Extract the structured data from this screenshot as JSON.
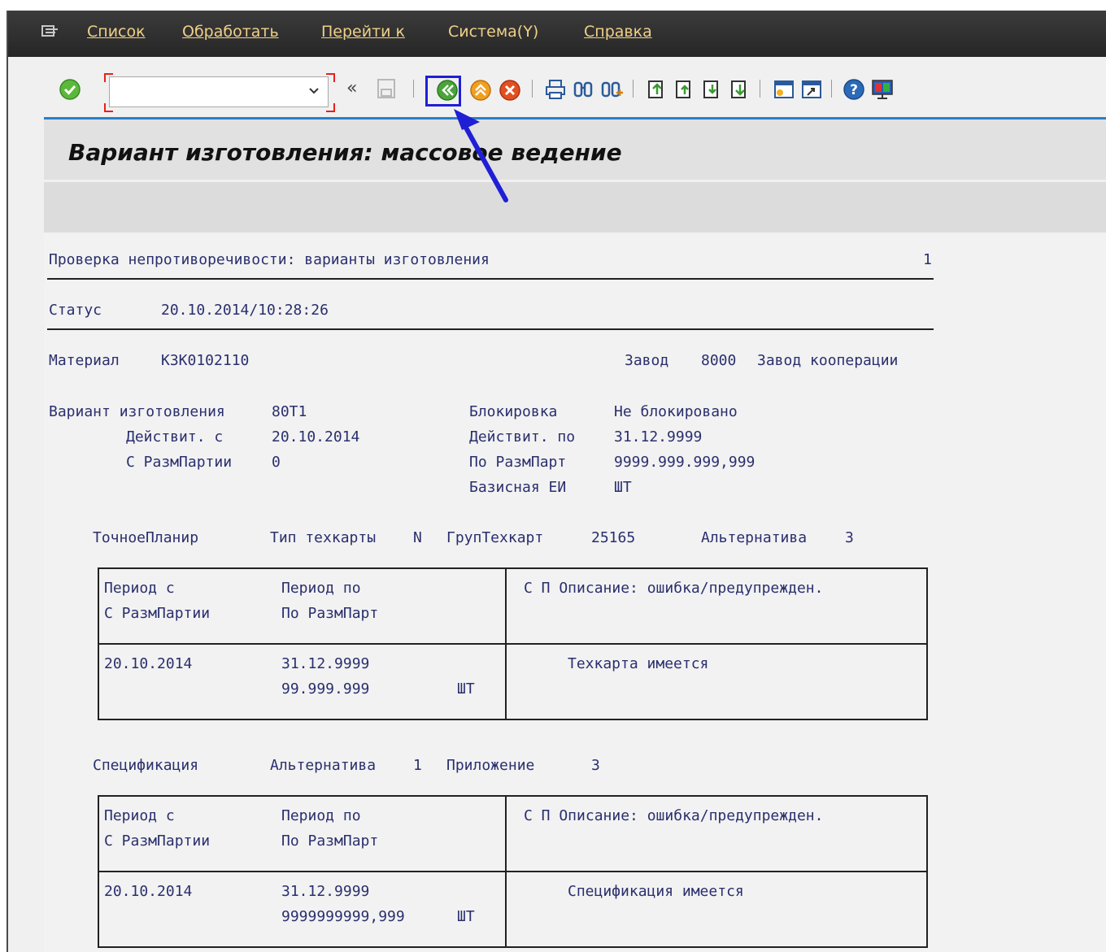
{
  "menu": {
    "items": [
      "Список",
      "Обработать",
      "Перейти к",
      "Система(Y)",
      "Справка"
    ]
  },
  "toolbar": {
    "command_value": "",
    "icons": [
      "enter-icon",
      "history-icon",
      "save-icon",
      "back-icon",
      "exit-icon",
      "cancel-icon",
      "print-icon",
      "find-icon",
      "find-next-icon",
      "first-page-icon",
      "previous-page-icon",
      "next-page-icon",
      "last-page-icon",
      "new-session-icon",
      "shortcut-icon",
      "help-icon",
      "customize-layout-icon"
    ],
    "highlighted": "back-icon"
  },
  "page": {
    "title": "Вариант изготовления: массовое ведение"
  },
  "report": {
    "header_title": "Проверка непротиворечивости: варианты изготовления",
    "page_number": "1",
    "status_label": "Статус",
    "status_value": "20.10.2014/10:28:26",
    "material_label": "Материал",
    "material_value": "КЗК0102110",
    "plant_label": "Завод",
    "plant_code": "8000",
    "plant_name": "Завод кооперации",
    "version_label": "Вариант изготовления",
    "version_value": "80Т1",
    "valid_from_label": "Действит. с",
    "valid_from_value": "20.10.2014",
    "lot_from_label": "С РазмПартии",
    "lot_from_value": "0",
    "lock_label": "Блокировка",
    "lock_value": "Не блокировано",
    "valid_to_label": "Действит. по",
    "valid_to_value": "31.12.9999",
    "lot_to_label": "По РазмПарт",
    "lot_to_value": "9999.999.999,999",
    "base_uom_label": "Базисная ЕИ",
    "base_uom_value": "ШТ",
    "routing_section": {
      "label": "ТочноеПланир",
      "type_label": "Тип техкарты",
      "type_value": "N",
      "group_label": "ГрупТехкарт",
      "group_value": "25165",
      "alt_label": "Альтернатива",
      "alt_value": "3"
    },
    "routing_table": {
      "h_period_from": "Период с",
      "h_lot_from": "С РазмПартии",
      "h_period_to": "Период по",
      "h_lot_to": "По РазмПарт",
      "h_desc": "С П Описание: ошибка/предупрежден.",
      "period_from": "20.10.2014",
      "period_to": "31.12.9999",
      "lot_to": "99.999.999",
      "uom": "ШТ",
      "desc": "Техкарта имеется"
    },
    "bom_section": {
      "label": "Спецификация",
      "alt_label": "Альтернатива",
      "alt_value": "1",
      "usage_label": "Приложение",
      "usage_value": "3"
    },
    "bom_table": {
      "h_period_from": "Период с",
      "h_lot_from": "С РазмПартии",
      "h_period_to": "Период по",
      "h_lot_to": "По РазмПарт",
      "h_desc": "С П Описание: ошибка/предупрежден.",
      "period_from": "20.10.2014",
      "period_to": "31.12.9999",
      "lot_to": "9999999999,999",
      "uom": "ШТ",
      "desc": "Спецификация имеется"
    }
  },
  "colors": {
    "menubar": "#2f2f2f",
    "menu_text": "#f0d088",
    "accent_line": "#2a7fc8",
    "report_text": "#2a2f6e",
    "annotation": "#1f1fd6"
  }
}
